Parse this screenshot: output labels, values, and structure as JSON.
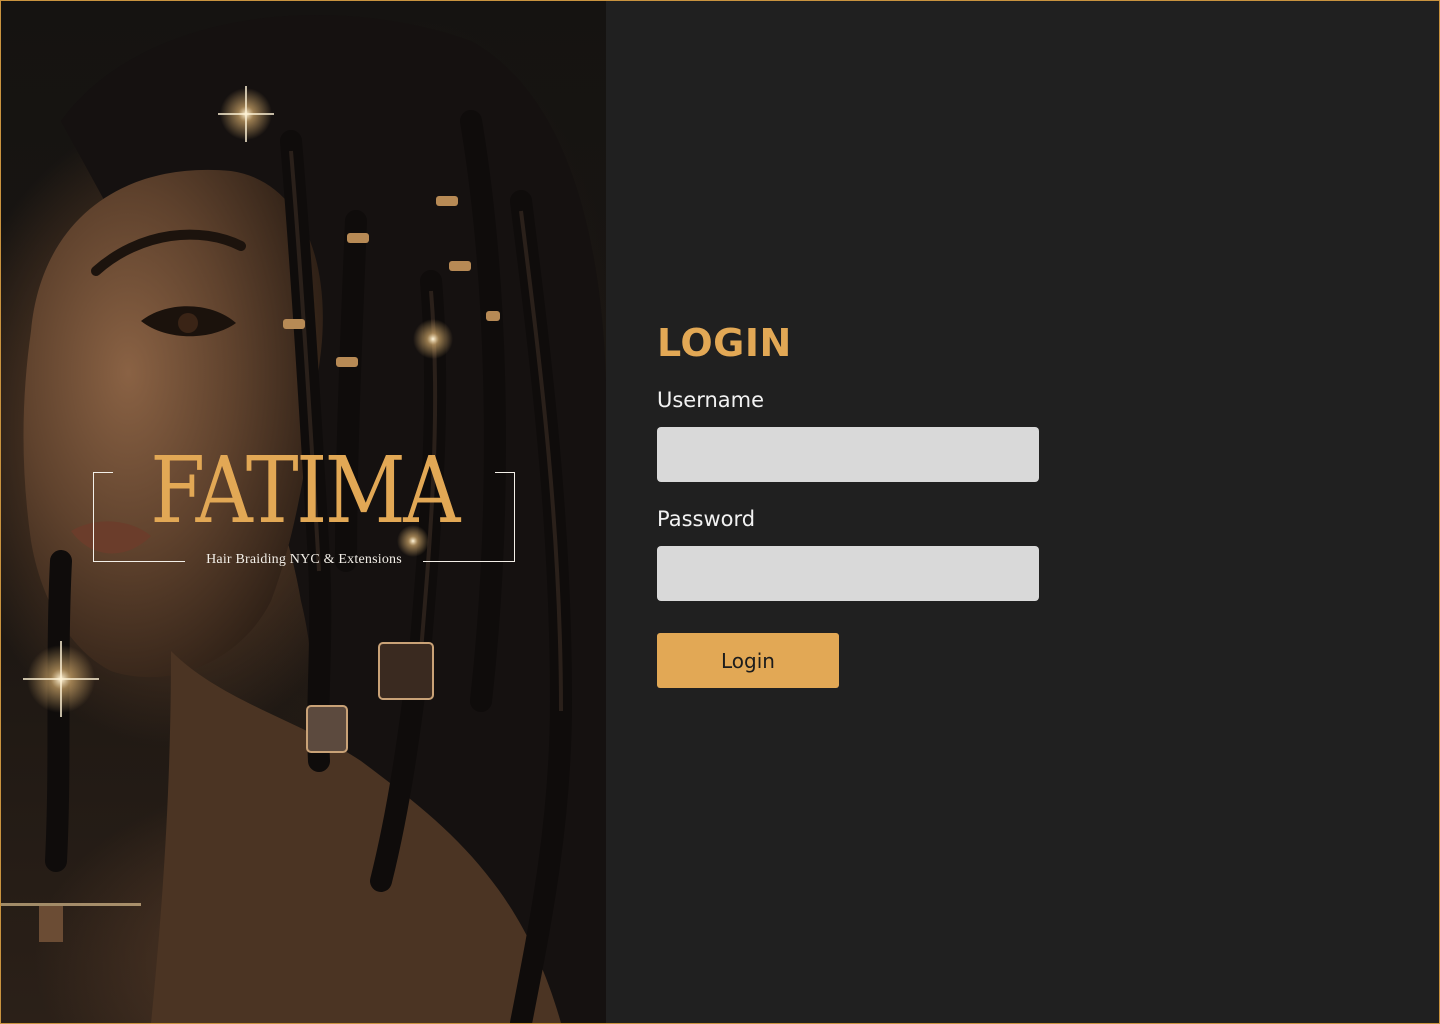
{
  "brand": {
    "name": "FATIMA",
    "tagline": "Hair Braiding NYC & Extensions"
  },
  "login": {
    "title": "LOGIN",
    "username_label": "Username",
    "username_value": "",
    "password_label": "Password",
    "password_value": "",
    "submit_label": "Login"
  },
  "colors": {
    "accent": "#e2a855",
    "panel_background": "#202020",
    "input_background": "#d9d9d9",
    "text_light": "#f2f2f2",
    "frame_border": "#c9933f"
  },
  "hero": {
    "image_subject": "portrait-with-braids"
  }
}
